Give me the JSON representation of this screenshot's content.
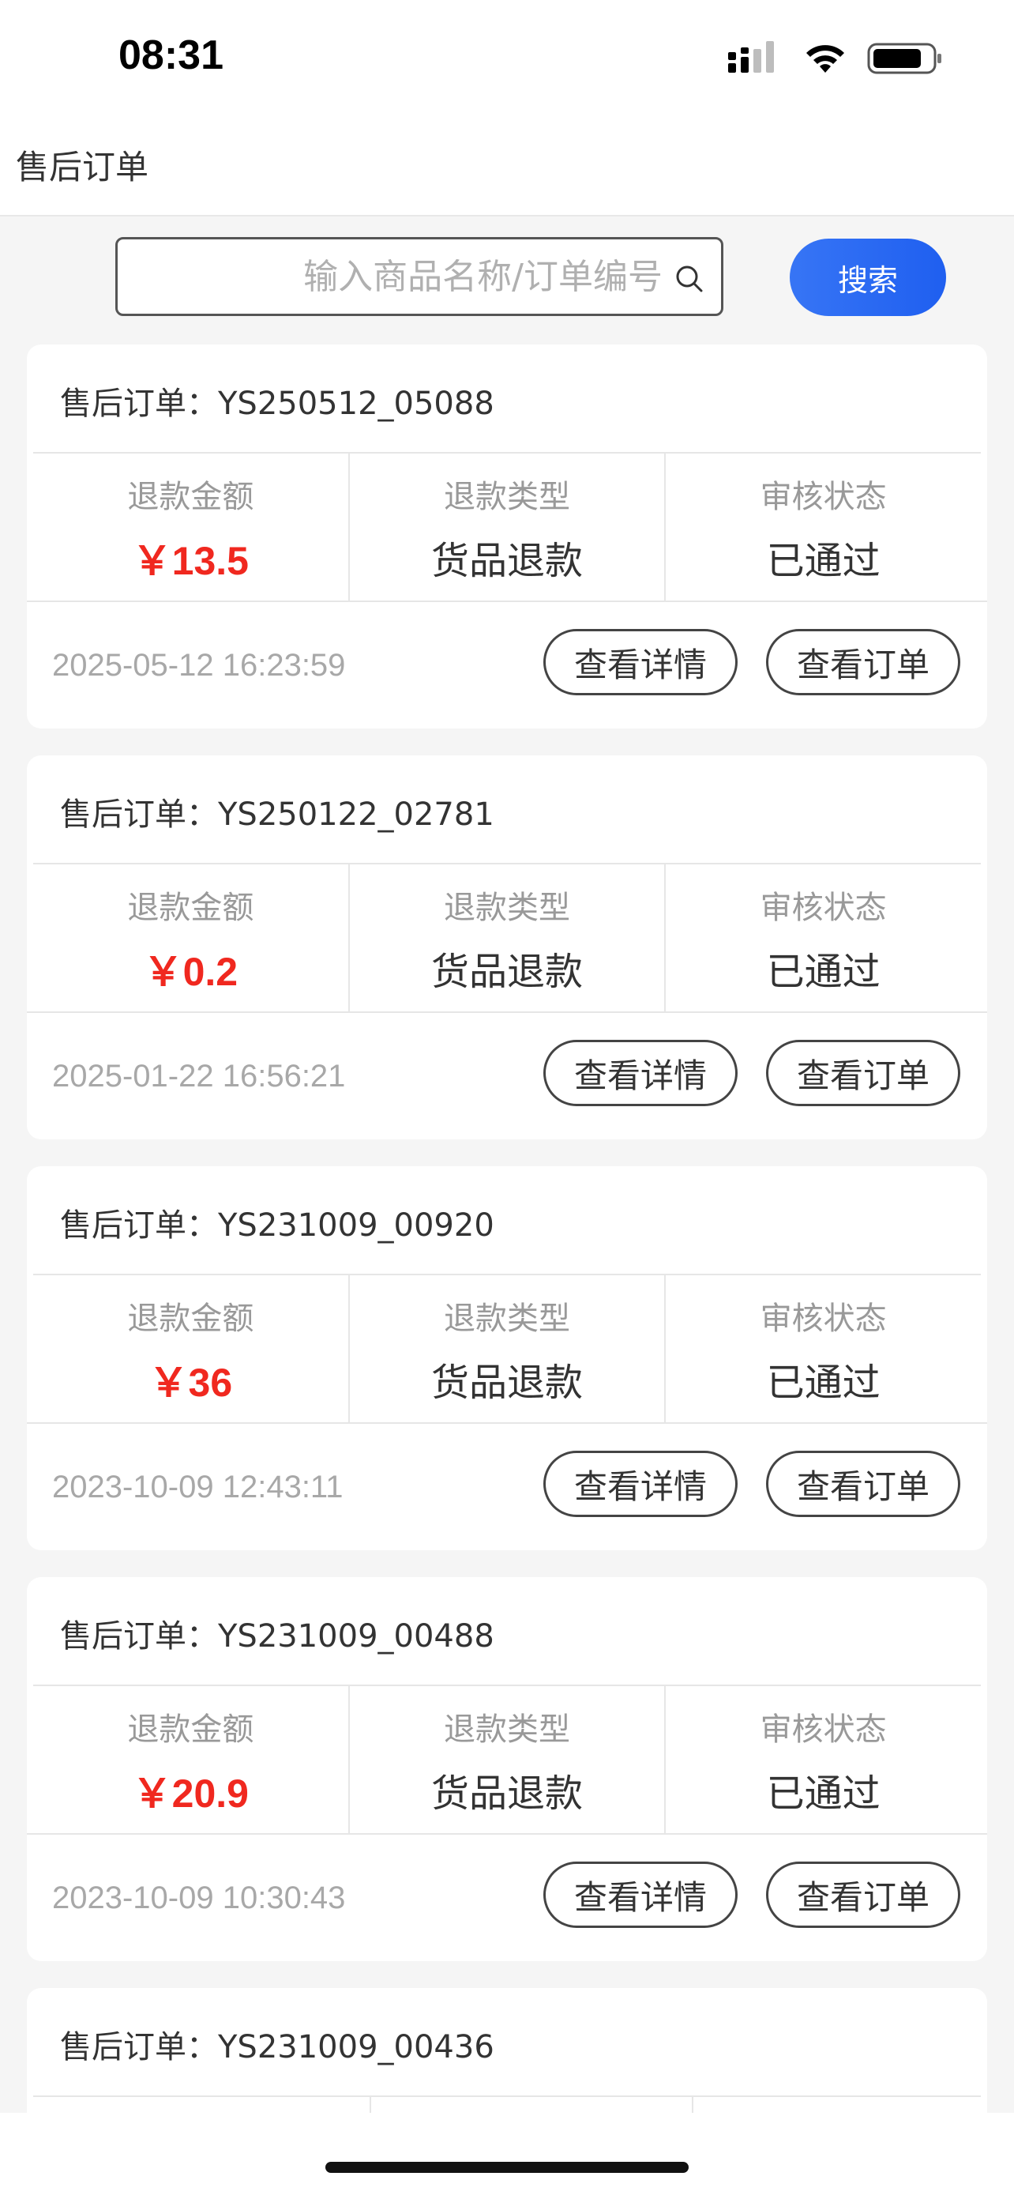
{
  "status_bar": {
    "time": "08:31"
  },
  "nav": {
    "title": "售后订单"
  },
  "search": {
    "placeholder": "输入商品名称/订单编号",
    "value": "",
    "button_label": "搜索"
  },
  "labels": {
    "order_prefix": "售后订单：",
    "refund_amount": "退款金额",
    "refund_type": "退款类型",
    "review_status": "审核状态",
    "view_detail": "查看详情",
    "view_order": "查看订单"
  },
  "orders": [
    {
      "order_no": "YS250512_05088",
      "amount": "￥13.5",
      "refund_type": "货品退款",
      "status": "已通过",
      "time": "2025-05-12 16:23:59"
    },
    {
      "order_no": "YS250122_02781",
      "amount": "￥0.2",
      "refund_type": "货品退款",
      "status": "已通过",
      "time": "2025-01-22 16:56:21"
    },
    {
      "order_no": "YS231009_00920",
      "amount": "￥36",
      "refund_type": "货品退款",
      "status": "已通过",
      "time": "2023-10-09 12:43:11"
    },
    {
      "order_no": "YS231009_00488",
      "amount": "￥20.9",
      "refund_type": "货品退款",
      "status": "已通过",
      "time": "2023-10-09 10:30:43"
    },
    {
      "order_no": "YS231009_00436"
    }
  ],
  "colors": {
    "accent_blue": "#2a66f2",
    "amount_red": "#f0281f",
    "background": "#f5f5f5"
  },
  "icons": {
    "search": "search-icon",
    "signal": "signal-icon",
    "wifi": "wifi-icon",
    "battery": "battery-icon"
  }
}
